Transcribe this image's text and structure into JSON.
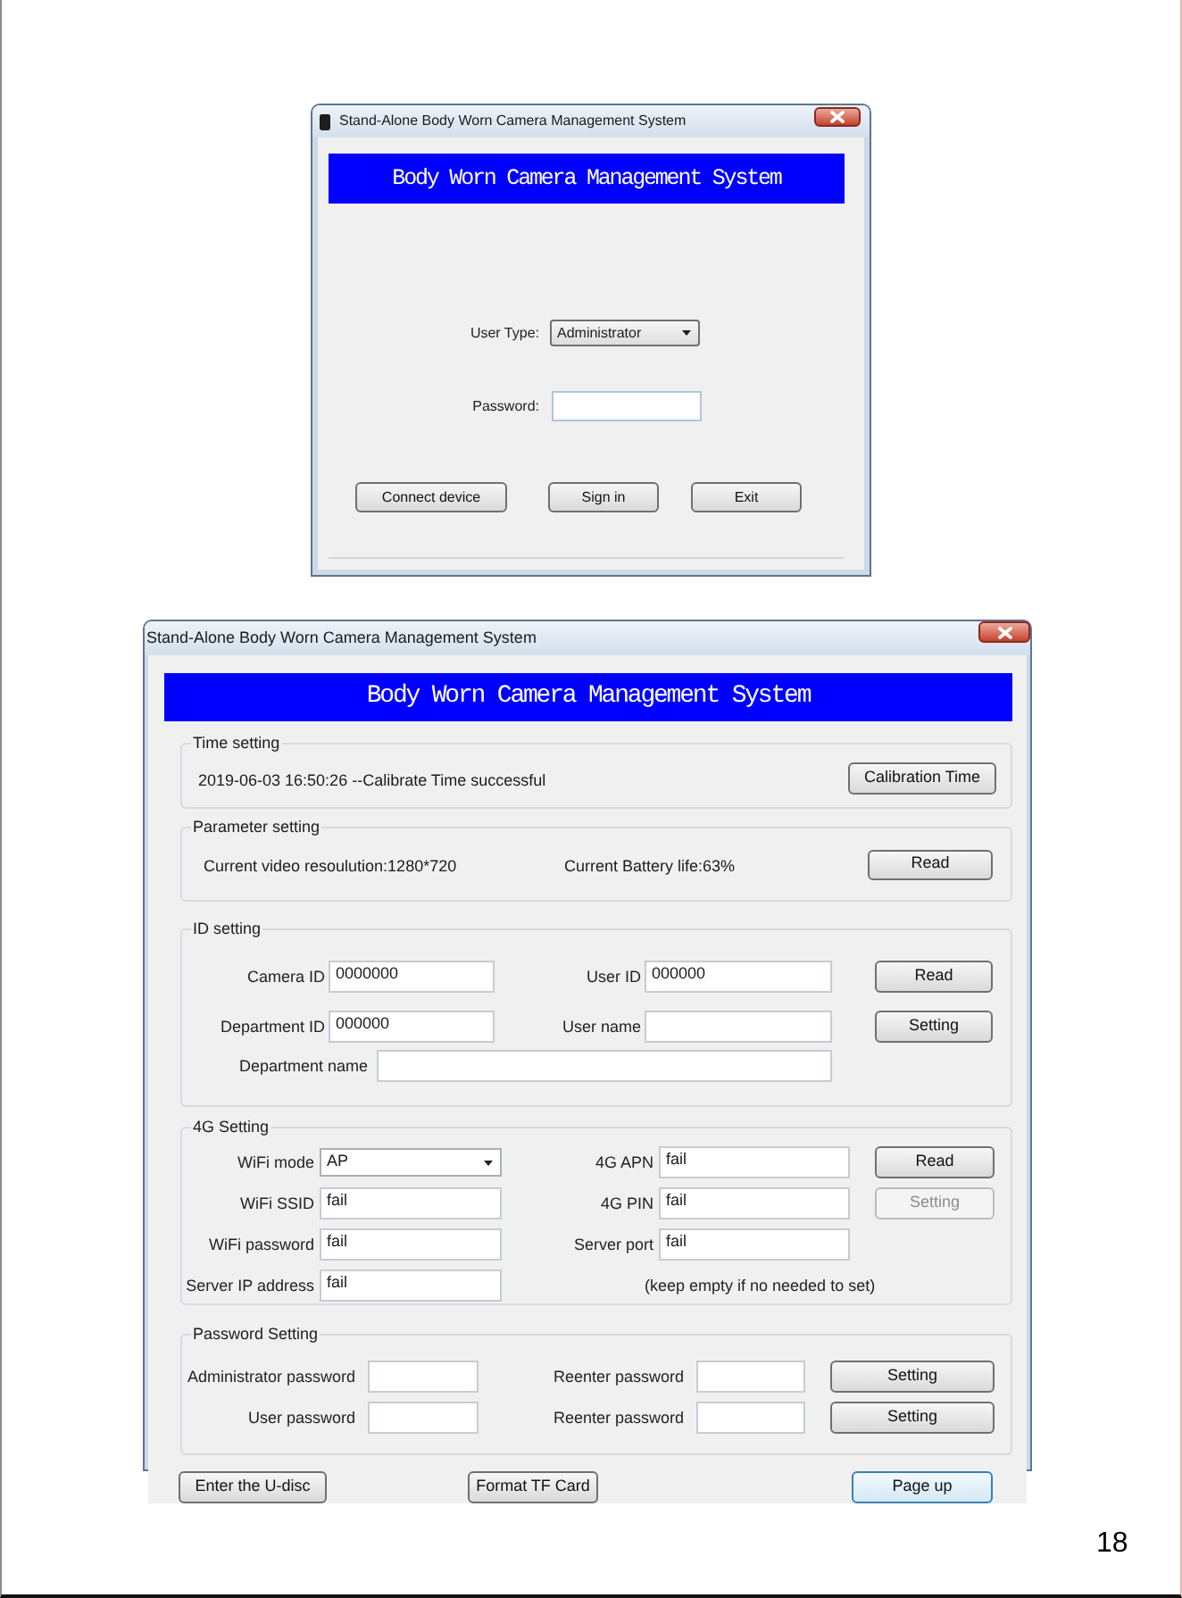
{
  "page": {
    "number": "18"
  },
  "login_window": {
    "title": "Stand-Alone Body Worn Camera Management System",
    "banner": "Body Worn Camera Management System",
    "fields": [
      {
        "kind": "dropdown",
        "label": "User Type:",
        "value": "Administrator"
      },
      {
        "kind": "text",
        "label": "Password:"
      }
    ],
    "buttons": [
      {
        "label": "Connect device"
      },
      {
        "label": "Sign in"
      },
      {
        "label": "Exit"
      }
    ]
  },
  "main_window": {
    "title": "Stand-Alone Body Worn Camera Management System",
    "banner": "Body Worn Camera Management System",
    "groups": [
      {
        "kind": "status",
        "title": "Time setting",
        "texts": [
          "2019-06-03 16:50:26 --Calibrate Time successful"
        ],
        "button": {
          "label": "Calibration Time",
          "disabled": false
        }
      },
      {
        "kind": "status",
        "title": "Parameter setting",
        "texts": [
          "Current video resoulution:1280*720",
          "Current Battery life:63%"
        ],
        "button": {
          "label": "Read",
          "disabled": false
        }
      },
      {
        "kind": "id_form",
        "title": "ID setting",
        "rows": [
          {
            "fields": [
              {
                "label": "Camera ID",
                "value": "0000000"
              },
              {
                "label": "User ID",
                "value": "000000"
              }
            ],
            "button": {
              "label": "Read",
              "disabled": false
            }
          },
          {
            "fields": [
              {
                "label": "Department ID",
                "value": "000000"
              },
              {
                "label": "User name"
              }
            ],
            "button": {
              "label": "Setting",
              "disabled": false
            }
          },
          {
            "fields": [
              {
                "label": "Department name"
              }
            ]
          }
        ]
      },
      {
        "kind": "network_form",
        "title": "4G Setting",
        "rows": [
          {
            "fields": [
              {
                "kind": "dropdown",
                "label": "WiFi mode",
                "value": "AP"
              },
              {
                "kind": "text",
                "label": "4G APN",
                "value": "fail"
              }
            ],
            "button": {
              "label": "Read",
              "disabled": false
            }
          },
          {
            "fields": [
              {
                "kind": "text",
                "label": "WiFi SSID",
                "value": "fail"
              },
              {
                "kind": "text",
                "label": "4G PIN",
                "value": "fail"
              }
            ],
            "button": {
              "label": "Setting",
              "disabled": true
            }
          },
          {
            "fields": [
              {
                "kind": "text",
                "label": "WiFi password",
                "value": "fail"
              },
              {
                "kind": "text",
                "label": "Server port",
                "value": "fail"
              }
            ]
          },
          {
            "fields": [
              {
                "kind": "text",
                "label": "Server IP address",
                "value": "fail"
              }
            ],
            "note": "(keep empty if no needed to set)"
          }
        ]
      },
      {
        "kind": "password_form",
        "title": "Password Setting",
        "rows": [
          {
            "fields": [
              {
                "label": "Administrator password"
              },
              {
                "label": "Reenter password"
              }
            ],
            "button": {
              "label": "Setting",
              "disabled": false
            }
          },
          {
            "fields": [
              {
                "label": "User password"
              },
              {
                "label": "Reenter password"
              }
            ],
            "button": {
              "label": "Setting",
              "disabled": false
            }
          }
        ]
      }
    ],
    "footer_buttons": [
      {
        "label": "Enter the U-disc",
        "focused": false
      },
      {
        "label": "Format TF Card",
        "focused": false
      },
      {
        "label": "Page up",
        "focused": true
      }
    ]
  }
}
